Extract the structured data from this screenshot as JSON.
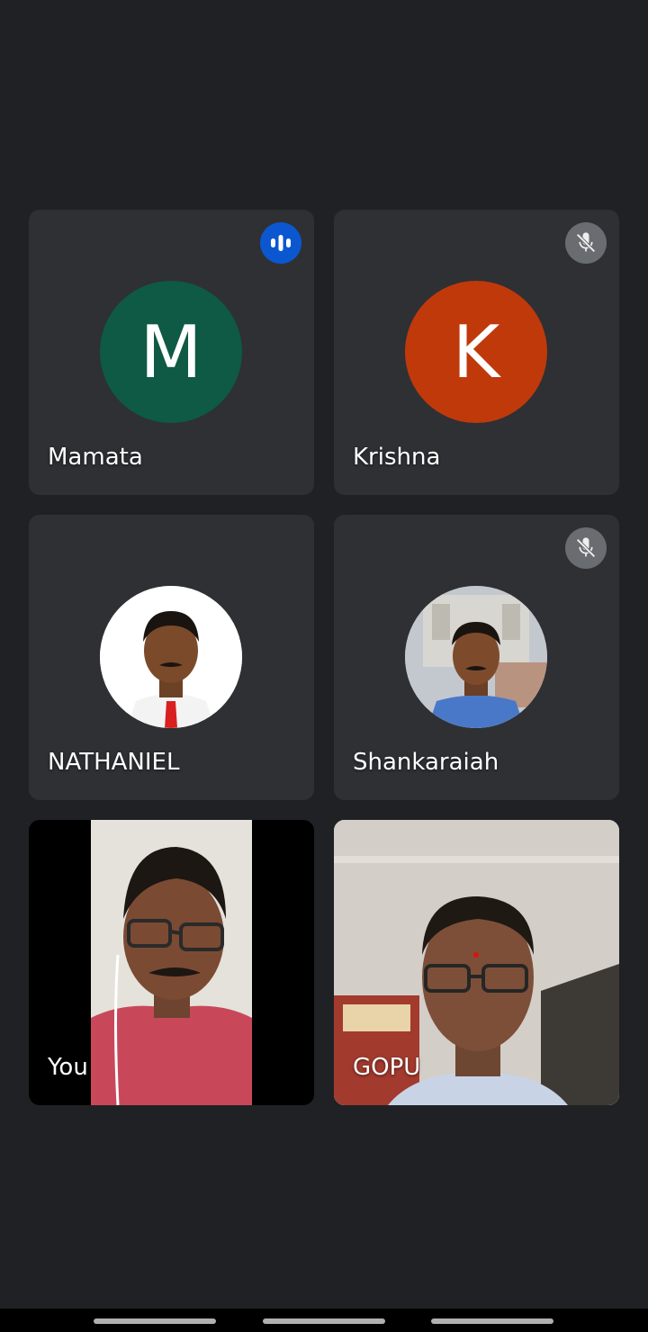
{
  "participants": [
    {
      "name": "Mamata",
      "initial": "M",
      "avatar_color": "#0e5a44",
      "status": "speaking",
      "status_icon": "audio-bars-icon"
    },
    {
      "name": "Krishna",
      "initial": "K",
      "avatar_color": "#c0390b",
      "status": "muted",
      "status_icon": "mic-off-icon"
    },
    {
      "name": "NATHANIEL",
      "status": "none",
      "avatar_type": "photo"
    },
    {
      "name": "Shankaraiah",
      "status": "muted",
      "status_icon": "mic-off-icon",
      "avatar_type": "photo"
    },
    {
      "name": "You",
      "video": "on"
    },
    {
      "name": "GOPU",
      "video": "on"
    }
  ],
  "colors": {
    "background": "#202124",
    "tile": "#3c4043",
    "speaking_badge": "#0b57d0",
    "muted_badge": "#6f7276"
  },
  "system_nav": {
    "buttons": [
      "back-button",
      "home-button",
      "recents-button"
    ]
  }
}
